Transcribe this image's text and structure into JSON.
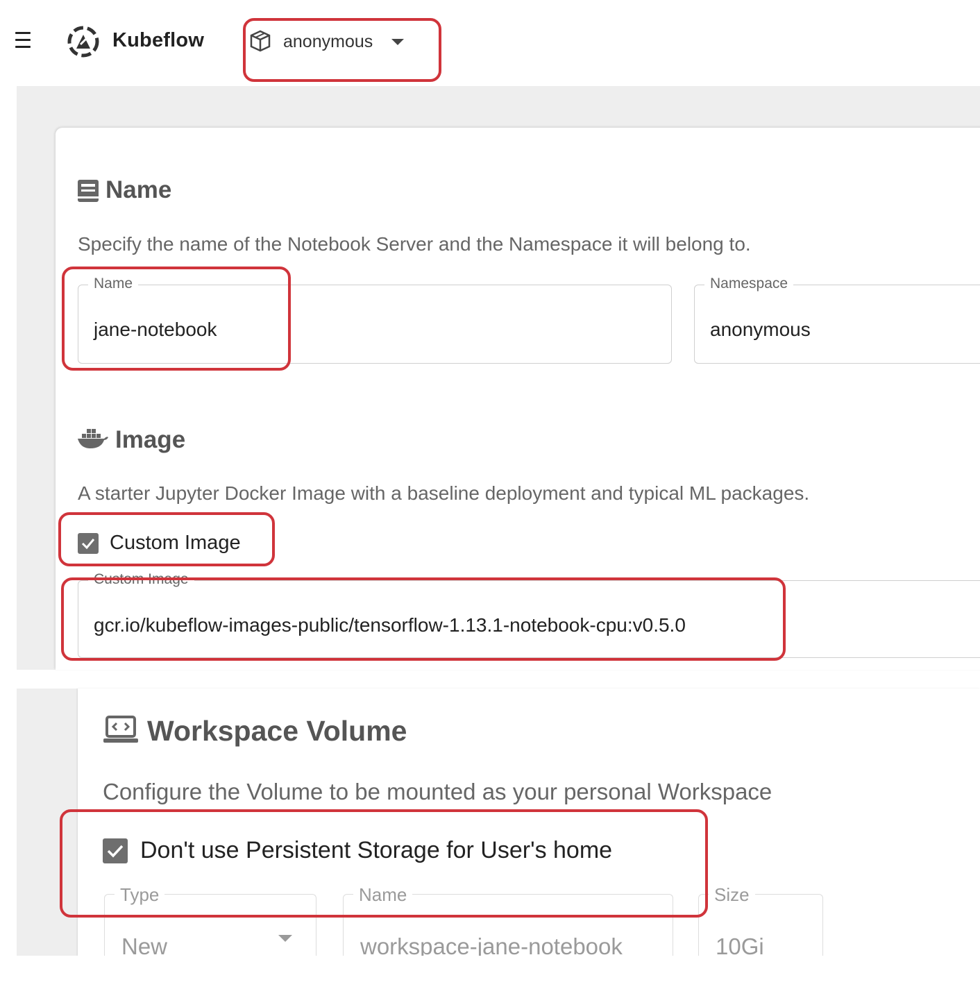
{
  "header": {
    "app_name": "Kubeflow",
    "namespace_selector": "anonymous",
    "icons": {
      "menu": "hamburger-menu-icon",
      "logo": "kubeflow-logo-icon",
      "namespace": "cube-icon",
      "dropdown": "caret-down-icon"
    }
  },
  "name_section": {
    "title": "Name",
    "icon": "notebook-icon",
    "description": "Specify the name of the Notebook Server and the Namespace it will belong to.",
    "name_field": {
      "label": "Name",
      "value": "jane-notebook"
    },
    "namespace_field": {
      "label": "Namespace",
      "value": "anonymous"
    }
  },
  "image_section": {
    "title": "Image",
    "icon": "docker-whale-icon",
    "description": "A starter Jupyter Docker Image with a baseline deployment and typical ML packages.",
    "custom_image_checkbox": {
      "label": "Custom Image",
      "checked": true
    },
    "custom_image_field": {
      "label": "Custom Image",
      "value": "gcr.io/kubeflow-images-public/tensorflow-1.13.1-notebook-cpu:v0.5.0"
    }
  },
  "workspace_section": {
    "title": "Workspace Volume",
    "icon": "laptop-code-icon",
    "description": "Configure the Volume to be mounted as your personal Workspace",
    "no_persistent_checkbox": {
      "label": "Don't use Persistent Storage for User's home",
      "checked": true
    },
    "type_field": {
      "label": "Type",
      "value": "New"
    },
    "name_field": {
      "label": "Name",
      "value": "workspace-jane-notebook"
    },
    "size_field": {
      "label": "Size",
      "value": "10Gi"
    }
  },
  "colors": {
    "annotation": "#d0343b",
    "page_background": "#eeeeee",
    "checkbox": "#6e6e6e"
  }
}
